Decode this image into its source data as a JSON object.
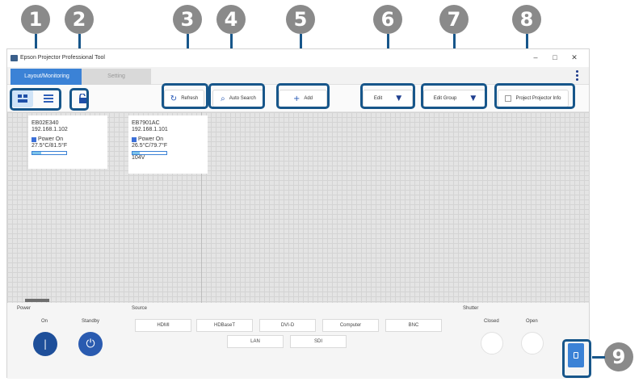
{
  "window": {
    "title": "Epson Projector Professional Tool",
    "controls": [
      "–",
      "□",
      "✕"
    ]
  },
  "tabs": [
    {
      "label": "Layout/Monitoring",
      "active": true
    },
    {
      "label": "Setting",
      "active": false
    }
  ],
  "toolbar": {
    "refresh_label": "Refresh",
    "auto_search_label": "Auto Search",
    "add_label": "Add",
    "edit_label": "Edit",
    "edit_group_label": "Edit Group",
    "project_info_label": "Project Projector Info"
  },
  "cards": [
    {
      "name": "EB02E340",
      "ip": "192.168.1.102",
      "status": "Power On",
      "temp": "27.5°C/81.5°F",
      "level": 0.25,
      "voltage": ""
    },
    {
      "name": "EB7901AC",
      "ip": "192.168.1.101",
      "status": "Power On",
      "temp": "26.5°C/79.7°F",
      "level": 0.22,
      "voltage": "104V"
    }
  ],
  "panel": {
    "power_label": "Power",
    "on_label": "On",
    "standby_label": "Standby",
    "source_label": "Source",
    "sources_row1": [
      "HDMI",
      "HDBaseT",
      "DVI-D",
      "Computer",
      "BNC"
    ],
    "sources_row2": [
      "LAN",
      "SDI"
    ],
    "shutter_label": "Shutter",
    "closed_label": "Closed",
    "open_label": "Open"
  },
  "callouts": [
    "1",
    "2",
    "3",
    "4",
    "5",
    "6",
    "7",
    "8",
    "9"
  ],
  "colors": {
    "accent": "#17568a",
    "tab_active": "#3b82d6",
    "power_button": "#1e4f9a",
    "callout": "#8a8a8a"
  },
  "icons": {
    "refresh": "refresh-icon",
    "search": "search-icon",
    "add": "plus-icon",
    "lock": "lock-icon"
  }
}
